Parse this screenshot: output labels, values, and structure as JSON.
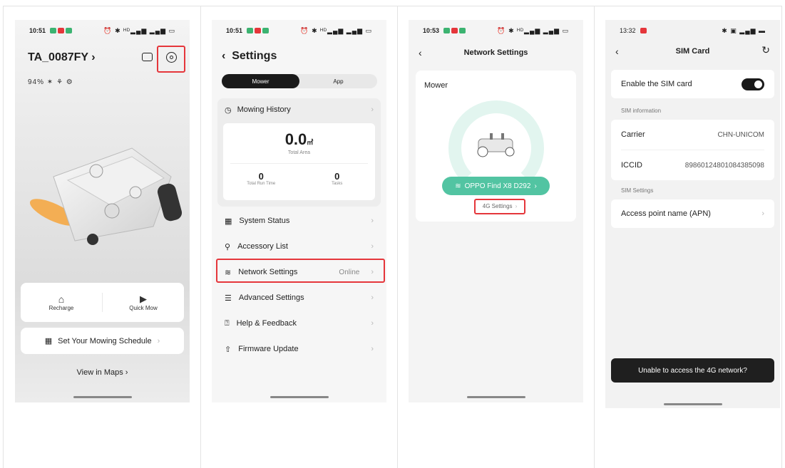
{
  "screen1": {
    "time": "10:51",
    "status_right": "⏰ ✱ ᴴᴰ▂▄▆ ▂▄▆ ▭",
    "title": "TA_0087FY",
    "stats": "94% ✶ ⚘ ⚙",
    "actions": [
      {
        "label": "Recharge"
      },
      {
        "label": "Quick Mow"
      }
    ],
    "schedule_label": "Set Your Mowing Schedule",
    "maps_label": "View in Maps"
  },
  "screen2": {
    "time": "10:51",
    "status_right": "⏰ ✱ ᴴᴰ▂▄▆ ▂▄▆ ▭",
    "title": "Settings",
    "tabs": [
      "Mower",
      "App"
    ],
    "history_label": "Mowing History",
    "total_area_value": "0.0",
    "total_area_unit": "㎡",
    "total_area_label": "Total Area",
    "run_time_value": "0",
    "run_time_label": "Total Run Time",
    "tasks_value": "0",
    "tasks_label": "Tasks",
    "menu": [
      {
        "label": "System Status"
      },
      {
        "label": "Accessory List"
      },
      {
        "label": "Network Settings",
        "value": "Online"
      },
      {
        "label": "Advanced Settings"
      },
      {
        "label": "Help & Feedback"
      },
      {
        "label": "Firmware Update"
      }
    ]
  },
  "screen3": {
    "time": "10:53",
    "status_right": "⏰ ✱ ᴴᴰ▂▄▆ ▂▄▆ ▭",
    "title": "Network Settings",
    "card_label": "Mower",
    "wifi_name": "OPPO Find X8 D292",
    "lte_label": "4G Settings"
  },
  "screen4": {
    "time": "13:32",
    "status_right": "✱ ▣ ▂▄▆ ▬",
    "title": "SIM Card",
    "enable_label": "Enable the SIM card",
    "sim_info_header": "SIM information",
    "carrier_label": "Carrier",
    "carrier_value": "CHN-UNICOM",
    "iccid_label": "ICCID",
    "iccid_value": "89860124801084385098",
    "sim_settings_header": "SIM Settings",
    "apn_label": "Access point name (APN)",
    "help_button": "Unable to access the 4G network?"
  }
}
